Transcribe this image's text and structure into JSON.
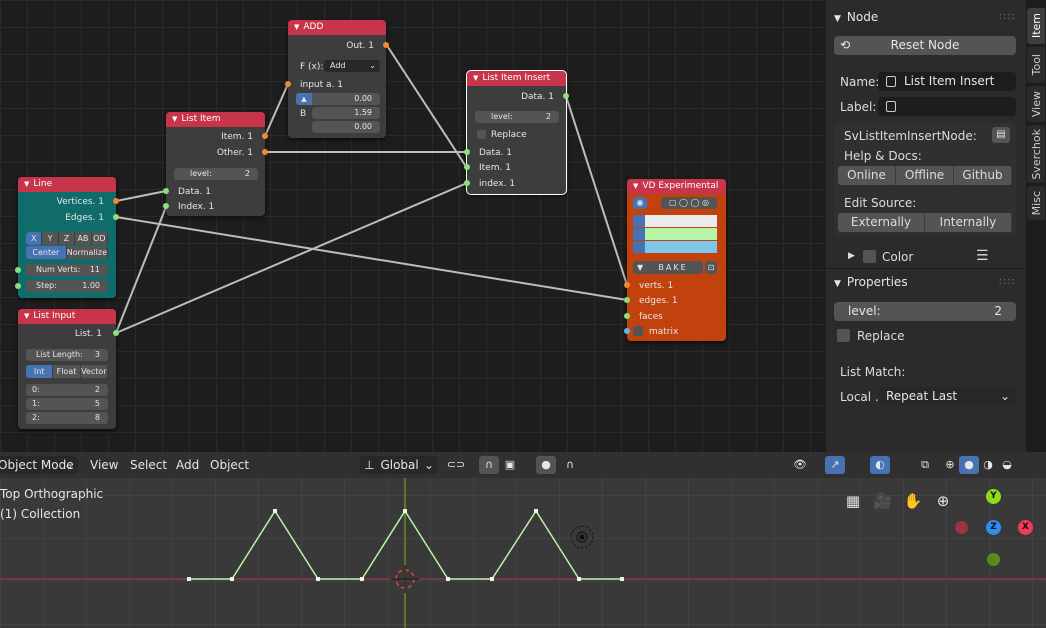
{
  "nodes": {
    "add": {
      "title": "ADD",
      "out": "Out. 1",
      "func_label": "F (x):",
      "func_value": "Add",
      "input_a": "input a. 1",
      "a_value": "0.00",
      "b_label": "B",
      "b_value": "1.59",
      "c_value": "0.00"
    },
    "list_item": {
      "title": "List Item",
      "item": "Item. 1",
      "other": "Other. 1",
      "level_label": "level:",
      "level_value": "2",
      "data": "Data. 1",
      "index": "Index. 1"
    },
    "list_item_insert": {
      "title": "List Item Insert",
      "data_out": "Data. 1",
      "level_label": "level:",
      "level_value": "2",
      "replace": "Replace",
      "data_in": "Data. 1",
      "item_in": "Item. 1",
      "index_in": "index. 1"
    },
    "line": {
      "title": "Line",
      "vertices": "Vertices. 1",
      "edges": "Edges. 1",
      "axes": [
        "X",
        "Y",
        "Z",
        "AB",
        "OD"
      ],
      "modes": [
        "Center",
        "Normalize"
      ],
      "num_verts_label": "Num Verts:",
      "num_verts": "11",
      "step_label": "Step:",
      "step": "1.00"
    },
    "list_input": {
      "title": "List Input",
      "out": "List. 1",
      "length_label": "List Length:",
      "length": "3",
      "types": [
        "Int",
        "Float",
        "Vector"
      ],
      "rows": [
        {
          "k": "0:",
          "v": "2"
        },
        {
          "k": "1:",
          "v": "5"
        },
        {
          "k": "2:",
          "v": "8"
        }
      ]
    },
    "vd": {
      "title": "VD Experimental",
      "bake": "BAKE",
      "verts": "verts. 1",
      "edges": "edges. 1",
      "faces": "faces",
      "matrix": "matrix",
      "colors": [
        "#ececec",
        "#b8f5a6",
        "#7ec7ea"
      ]
    }
  },
  "sidebar": {
    "node_panel": "Node",
    "reset_node": "Reset Node",
    "name_label": "Name:",
    "name_value": "List Item Insert",
    "label_label": "Label:",
    "label_value": "",
    "class_name": "SvListItemInsertNode:",
    "help_label": "Help & Docs:",
    "help_buttons": [
      "Online",
      "Offline",
      "Github"
    ],
    "edit_label": "Edit Source:",
    "edit_buttons": [
      "Externally",
      "Internally"
    ],
    "color_label": "Color",
    "properties_panel": "Properties",
    "level_label": "level:",
    "level_value": "2",
    "replace_label": "Replace",
    "list_match_label": "List Match:",
    "local_label": "Local ..",
    "local_value": "Repeat Last",
    "tabs": [
      "Item",
      "Tool",
      "View",
      "Sverchok",
      "Misc"
    ]
  },
  "viewport": {
    "mode": "Object Mode",
    "menus": [
      "View",
      "Select",
      "Add",
      "Object"
    ],
    "orientation": "Global",
    "view_name": "Top Orthographic",
    "collection": "(1) Collection",
    "axes": {
      "x": "X",
      "y": "Y",
      "z": "Z"
    }
  },
  "colors": {
    "node_header_red": "#c8354a",
    "line_node_body": "#106c6a",
    "vd_node_body": "#c2420d",
    "accent_blue": "#4772b3"
  }
}
